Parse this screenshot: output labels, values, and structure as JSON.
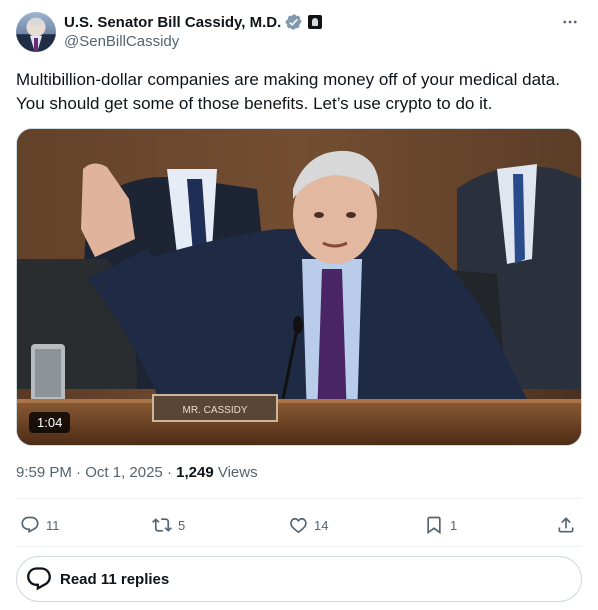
{
  "author": {
    "display_name": "U.S. Senator Bill Cassidy, M.D.",
    "handle": "@SenBillCassidy",
    "verified": true,
    "badge_color": "#829aab"
  },
  "post": {
    "text": "Multibillion-dollar companies are making money off of your medical data. You should get some of those benefits. Let’s use crypto to do it.",
    "media": {
      "duration": "1:04",
      "nameplate": "MR. CASSIDY"
    },
    "time": "9:59 PM",
    "date": "Oct 1, 2025",
    "separator": "·",
    "views_count": "1,249",
    "views_label": "Views"
  },
  "actions": {
    "replies": "11",
    "reposts": "5",
    "likes": "14",
    "bookmarks": "1"
  },
  "read_replies": {
    "label": "Read 11 replies"
  },
  "colors": {
    "text_primary": "#0f1419",
    "text_secondary": "#536471",
    "border": "#cfd9de"
  }
}
